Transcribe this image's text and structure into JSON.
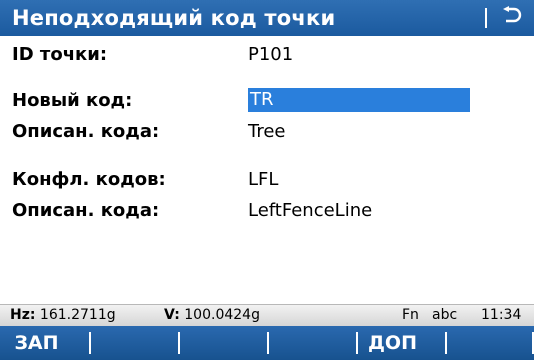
{
  "header": {
    "title": "Неподходящий код точки",
    "back_icon": "return-arrow-icon"
  },
  "fields": {
    "point_id": {
      "label": "ID точки:",
      "value": "P101"
    },
    "new_code": {
      "label": "Новый код:",
      "value": "TR"
    },
    "new_code_desc": {
      "label": "Описан. кода:",
      "value": "Tree"
    },
    "conflict_codes": {
      "label": "Конфл. кодов:",
      "value": "LFL"
    },
    "conflict_desc": {
      "label": "Описан. кода:",
      "value": "LeftFenceLine"
    }
  },
  "status": {
    "hz_label": "Hz:",
    "hz_value": "161.2711g",
    "v_label": "V:",
    "v_value": "100.0424g",
    "fn": "Fn",
    "input_mode": "abc",
    "time": "11:34"
  },
  "softkeys": [
    {
      "label": "ЗАП"
    },
    {
      "label": ""
    },
    {
      "label": ""
    },
    {
      "label": ""
    },
    {
      "label": "ДОП"
    },
    {
      "label": ""
    }
  ],
  "colors": {
    "titlebar": "#1f5fa6",
    "selection": "#2a7fdc",
    "softkey_bar": "#1e5c9e"
  }
}
